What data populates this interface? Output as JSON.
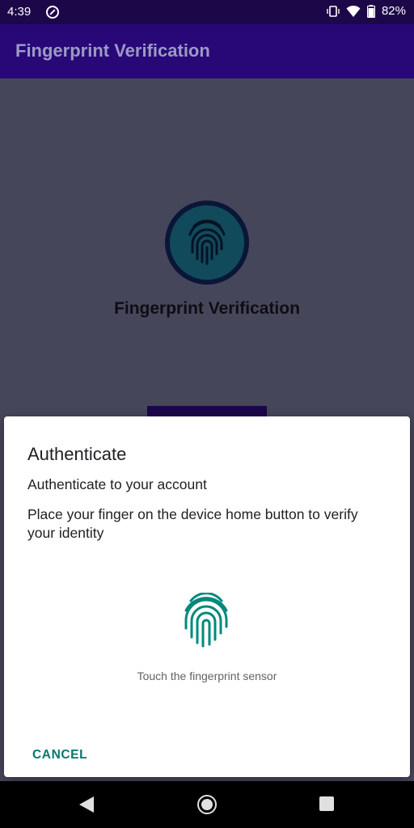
{
  "status_bar": {
    "time": "4:39",
    "battery_percent": "82%",
    "icons": [
      "dnd-icon",
      "vibrate-icon",
      "wifi-icon",
      "battery-icon"
    ]
  },
  "app_bar": {
    "title": "Fingerprint Verification"
  },
  "main": {
    "hero_title": "Fingerprint Verification"
  },
  "dialog": {
    "title": "Authenticate",
    "subtitle": "Authenticate to your account",
    "description": "Place your finger on the device home button to verify your identity",
    "hint": "Touch the fingerprint sensor",
    "cancel_label": "CANCEL"
  },
  "colors": {
    "app_bar": "#280877",
    "scrim_content": "#46465a",
    "accent": "#00796b"
  }
}
